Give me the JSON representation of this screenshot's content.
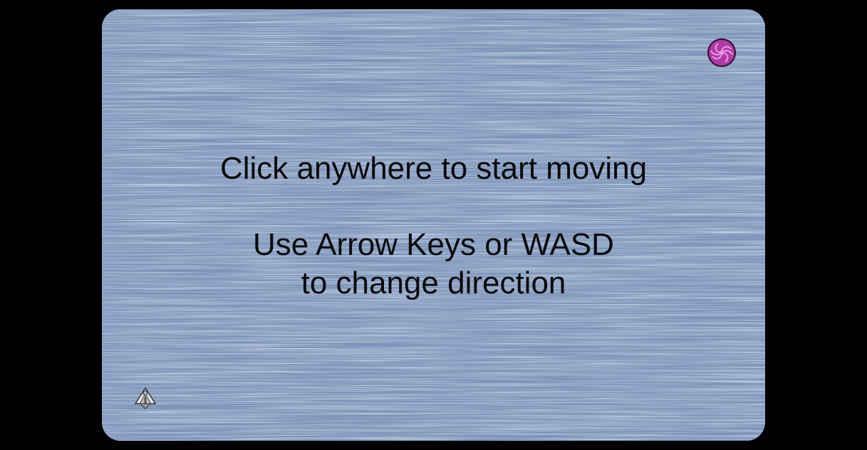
{
  "game": {
    "instruction_start": "Click anywhere to start moving",
    "instruction_keys_line1": "Use Arrow Keys or WASD",
    "instruction_keys_line2": "to change direction"
  },
  "icons": {
    "pickup": "swirl-candy-icon",
    "player": "ship-icon"
  },
  "colors": {
    "background": "#000000",
    "board": "#7b93b8",
    "text": "#0a0a0a",
    "candy": "#b03aa8"
  }
}
